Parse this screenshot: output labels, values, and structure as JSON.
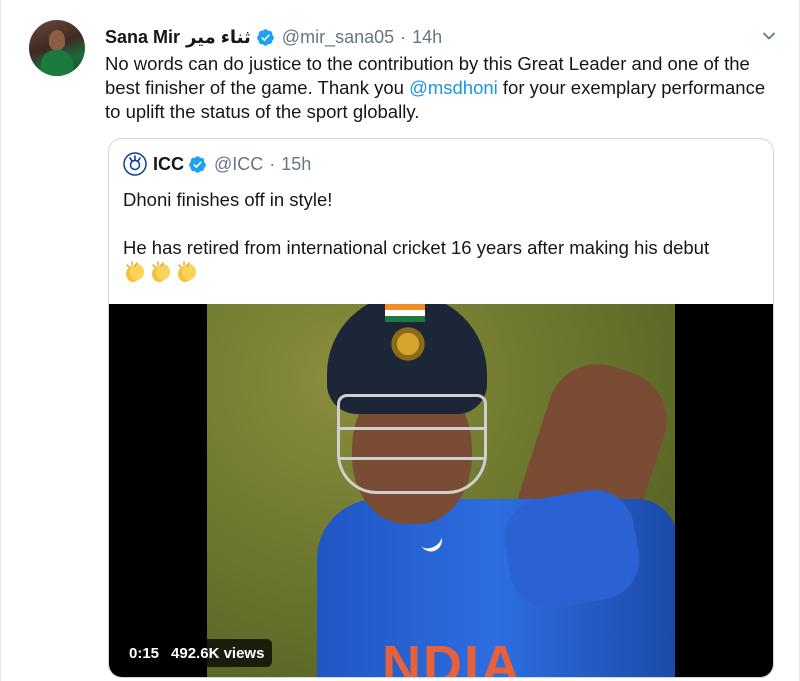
{
  "tweet": {
    "display_name": "Sana Mir",
    "arabic_name": "ثناء میر",
    "handle": "@mir_sana05",
    "separator": "·",
    "time": "14h",
    "text_part1": "No words can do justice to the contribution by this Great Leader and one of the best finisher of the game. Thank you ",
    "mention": "@msdhoni",
    "text_part2": " for your exemplary performance to uplift the status of the sport globally."
  },
  "quoted_tweet": {
    "display_name": "ICC",
    "handle": "@ICC",
    "separator": "·",
    "time": "15h",
    "line1": "Dhoni finishes off in style!",
    "line2": "He has retired from international cricket 16 years after making his debut",
    "emoji": [
      "👏",
      "👏",
      "👏"
    ],
    "video": {
      "duration": "0:15",
      "views": "492.6K views",
      "jersey_text": "NDIA"
    }
  },
  "colors": {
    "link": "#1b95e0",
    "verified": "#1da1f2",
    "secondary_text": "#657786",
    "border": "#ccd6dd"
  },
  "icons": [
    "verified-badge-icon",
    "caret-down-icon",
    "icc-logo",
    "clapping-hands-icon"
  ]
}
